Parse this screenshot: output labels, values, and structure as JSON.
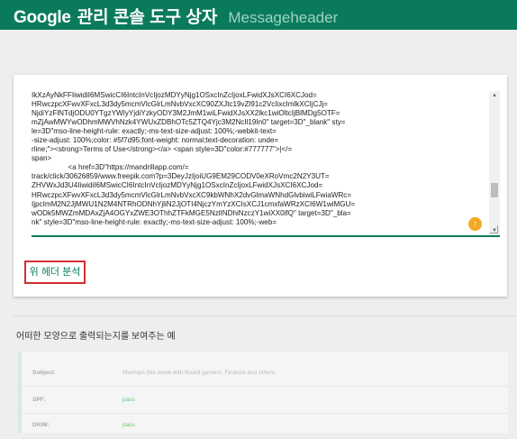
{
  "app": {
    "brand_google": "Google",
    "brand_korean": "관리 콘솔 도구 상자",
    "app_name": "Messageheader"
  },
  "colors": {
    "header_green": "#0a7a5c",
    "accent_orange": "#f2a825",
    "highlight_red": "#d32f2f",
    "pass_green": "#6fc27a"
  },
  "header_input": {
    "content": "IkXzAyNkFFIiwidiI6MSwicCI6IntcInVcIjozMDYyNjg1OSxcInZcIjoxLFwidXJsXCI6XCJod=\nHRwczpcXFwvXFxcL3d3dy5mcmVlcGlrLmNvbVxcXC90ZXJtc19vZl91c2VcIixcImlkXCIjCJj=\nNjdiYzFlNTdjODU0YTgzYWIyYjdiYzkyODY3M2JmM1wiLFwidXJsXX2lkc1wiOltcIjBlMDg5OTF=\nmZjAwMWYwODhmMWVhNzk4YWUxZDBhOTc5ZTQ4Yjc3M2NcIl19In0\" target=3D\"_blank\" sty=\nle=3D\"mso-line-height-rule: exactly;-ms-text-size-adjust: 100%;-webkit-text=\n-size-adjust: 100%;color: #5f7d95;font-weight: normal;text-decoration: unde=\nrline;\"><strong>Terms of Use</strong></a> <span style=3D\"color:#777777\">|</=\nspan>\n                  <a href=3D\"https://mandrillapp.com/=\ntrack/click/30626859/www.freepik.com?p=3DeyJzIjoiUG9EM29CODV0eXRoVmc2N2Y3UT=\nZHVWxJd3U4IiwidiI6MSwicCI6IntcInVcIjozMDYyNjg1OSxcInZcIjoxLFwidXJsXCI6XCJod=\nHRwczpcXFwvXFxcL3d3dy5mcmVlcGlrLmNvbVxcXC9kbWNhX2dvGlmaWNhdGlvbiwiLFwiaWRc=\nIjpcImM2N2JjMWU1N2M4NTRhODNhYjliN2JjOTI4NjczYmYzXCIsXCJ1cmxfaWRzXCI6W1wiMGU=\nwODk5MWZmMDAxZjA4OGYxZWE3OThhZTFkMGE5NzlINDhiNzczY1wiXX0ifQ\" target=3D\"_bla=\nnk\" style=3D\"mso-line-height-rule: exactly;-ms-text-size-adjust: 100%;-web="
  },
  "buttons": {
    "analyze_label": "위 헤더 분석",
    "scroll_top_glyph": "↑"
  },
  "example": {
    "title": "어떠한 모양으로 출력되는지를 보여주는 예",
    "rows": [
      {
        "label": "Subject:",
        "value": "Meetups this week with Board gamers, Finance and others"
      },
      {
        "label": "SPF:",
        "value": "pass"
      },
      {
        "label": "DKIM:",
        "value": "pass"
      }
    ]
  }
}
